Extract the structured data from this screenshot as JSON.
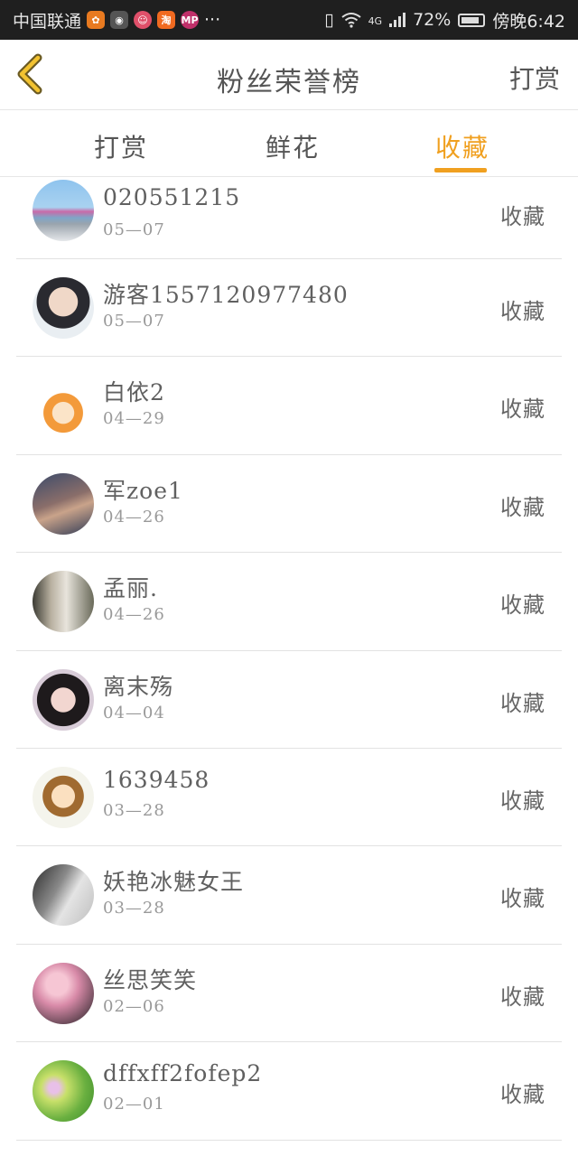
{
  "status_bar": {
    "carrier": "中国联通",
    "network": "4G",
    "battery": "72%",
    "time": "傍晚6:42",
    "more": "···"
  },
  "header": {
    "back_icon": "chevron-left-icon",
    "title": "粉丝荣誉榜",
    "action_label": "打赏"
  },
  "tabs": [
    {
      "label": "打赏",
      "active": false
    },
    {
      "label": "鲜花",
      "active": false
    },
    {
      "label": "收藏",
      "active": true
    }
  ],
  "colors": {
    "accent": "#f0a020",
    "text": "#555555",
    "divider": "#e2e2e2",
    "statusbar": "#1f1f1f"
  },
  "list": [
    {
      "name": "020551215",
      "date": "05—07",
      "action": "收藏"
    },
    {
      "name": "游客1557120977480",
      "date": "05—07",
      "action": "收藏"
    },
    {
      "name": "白依2",
      "date": "04—29",
      "action": "收藏"
    },
    {
      "name": "军zoe1",
      "date": "04—26",
      "action": "收藏"
    },
    {
      "name": "孟丽.",
      "date": "04—26",
      "action": "收藏"
    },
    {
      "name": "离末殇",
      "date": "04—04",
      "action": "收藏"
    },
    {
      "name": "1639458",
      "date": "03—28",
      "action": "收藏"
    },
    {
      "name": "妖艳冰魅女王",
      "date": "03—28",
      "action": "收藏"
    },
    {
      "name": "丝思笑笑",
      "date": "02—06",
      "action": "收藏"
    },
    {
      "name": "dffxff2fofep2",
      "date": "02—01",
      "action": "收藏"
    }
  ]
}
